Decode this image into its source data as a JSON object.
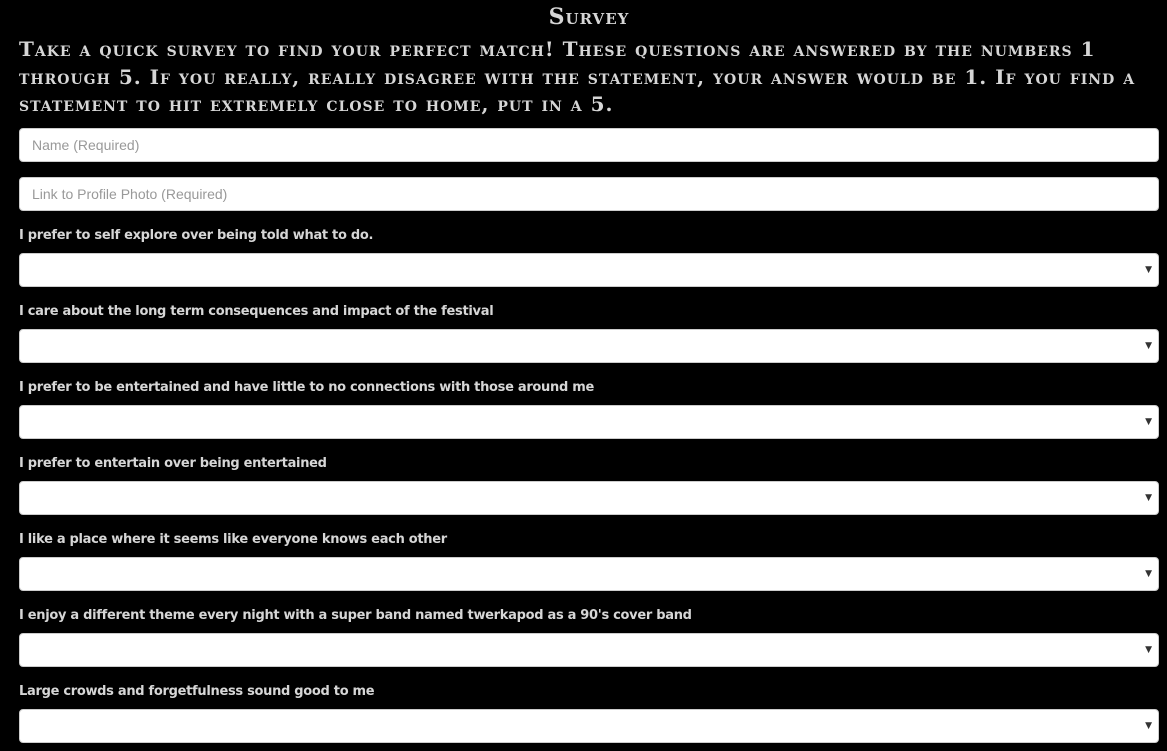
{
  "survey": {
    "title": "Survey",
    "intro": "Take a quick survey to find your perfect match! These questions are answered by the numbers 1 through 5. If you really, really disagree with the statement, your answer would be 1. If you find a statement to hit extremely close to home, put in a 5.",
    "name_placeholder": "Name (Required)",
    "photo_placeholder": "Link to Profile Photo (Required)",
    "dropdown_arrow_icon": "triangle-down",
    "questions": [
      {
        "label": "I prefer to self explore over being told what to do.",
        "selected": ""
      },
      {
        "label": "I care about the long term consequences and impact of the festival",
        "selected": ""
      },
      {
        "label": "I prefer to be entertained and have little to no connections with those around me",
        "selected": ""
      },
      {
        "label": "I prefer to entertain over being entertained",
        "selected": ""
      },
      {
        "label": "I like a place where it seems like everyone knows each other",
        "selected": ""
      },
      {
        "label": "I enjoy a different theme every night with a super band named twerkapod as a 90's cover band",
        "selected": ""
      },
      {
        "label": "Large crowds and forgetfulness sound good to me",
        "selected": ""
      }
    ]
  }
}
